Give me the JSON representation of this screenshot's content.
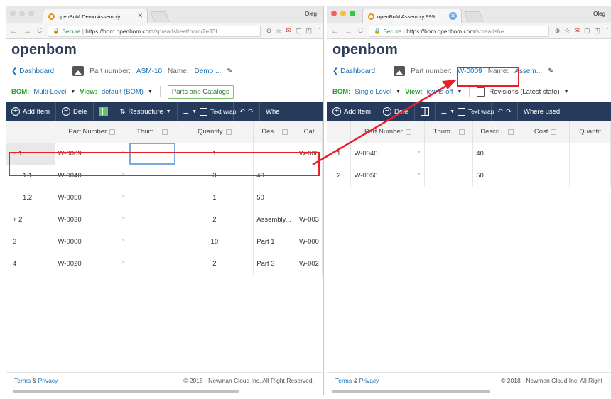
{
  "left": {
    "tab_title": "openBoM Demo Assembly",
    "user": "Oleg",
    "url": {
      "secure": "Secure",
      "host": "https://bom.openbom.com",
      "path": "/spreadsheet/bom/2e33f..."
    },
    "logo": "openbom",
    "dashboard": "Dashboard",
    "part_number_label": "Part number:",
    "part_number": "ASM-10",
    "name_label": "Name:",
    "name": "Demo ...",
    "bom_label": "BOM:",
    "bom_value": "Multi-Level",
    "view_label": "View:",
    "view_value": "default (BOM)",
    "parts_catalogs": "Parts and Catalogs",
    "toolbar": {
      "add_item": "Add Item",
      "delete": "Dele",
      "restructure": "Restructure",
      "text_wrap": "Text wrap",
      "where": "Whe"
    },
    "columns": [
      "",
      "Part Number",
      "Thum...",
      "Quantity",
      "Des...",
      "Cat"
    ],
    "rows": [
      {
        "idx": "− 1",
        "part": "W-0009",
        "qty": "1",
        "desc": "",
        "cat": "W-000"
      },
      {
        "idx": "1.1",
        "part": "W-0040",
        "qty": "3",
        "desc": "40",
        "cat": ""
      },
      {
        "idx": "1.2",
        "part": "W-0050",
        "qty": "1",
        "desc": "50",
        "cat": ""
      },
      {
        "idx": "+ 2",
        "part": "W-0030",
        "qty": "2",
        "desc": "Assembly...",
        "cat": "W-003"
      },
      {
        "idx": "3",
        "part": "W-0000",
        "qty": "10",
        "desc": "Part 1",
        "cat": "W-000"
      },
      {
        "idx": "4",
        "part": "W-0020",
        "qty": "2",
        "desc": "Part 3",
        "cat": "W-002"
      }
    ],
    "footer_terms": "Terms",
    "footer_amp": "&",
    "footer_privacy": "Privacy",
    "copyright": "© 2018 - Newman Cloud Inc. All Right Reserved."
  },
  "right": {
    "tab_title": "openBoM Assembly 999",
    "user": "Oleg",
    "url": {
      "secure": "Secure",
      "host": "https://bom.openbom.com",
      "path": "/spreadshe..."
    },
    "logo": "openbom",
    "dashboard": "Dashboard",
    "part_number_label": "Part number:",
    "part_number": "W-0009",
    "name_label": "Name:",
    "name": "Assem...",
    "bom_label": "BOM:",
    "bom_value": "Single Level",
    "view_label": "View:",
    "view_value": "iew is off",
    "revisions": "Revisions (Latest state)",
    "toolbar": {
      "add_item": "Add Item",
      "delete": "Dele",
      "text_wrap": "Text wrap",
      "where_used": "Where used"
    },
    "columns": [
      "",
      "Part Number",
      "Thum...",
      "Descri...",
      "Cost",
      "Quantit"
    ],
    "rows": [
      {
        "idx": "1",
        "part": "W-0040",
        "desc": "40"
      },
      {
        "idx": "2",
        "part": "W-0050",
        "desc": "50"
      }
    ],
    "footer_terms": "Terms",
    "footer_amp": "&",
    "footer_privacy": "Privacy",
    "copyright": "© 2018 - Newman Cloud Inc. All Right"
  },
  "colors": {
    "highlight": "#e8202a",
    "toolbar": "#263a5c",
    "accent": "#1a6fb4",
    "bom_green": "#2ca02c"
  }
}
